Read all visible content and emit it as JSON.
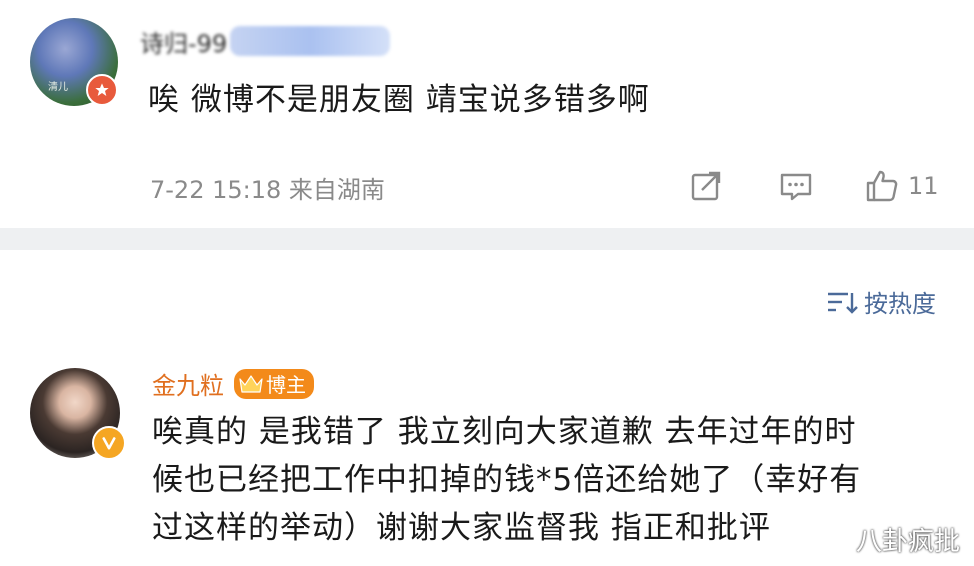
{
  "post": {
    "avatar_caption": "清儿",
    "username_partial": "诗归-99",
    "text": "唉 微博不是朋友圈 靖宝说多错多啊",
    "meta": "7-22 15:18 来自湖南",
    "like_count": "11"
  },
  "comments": {
    "sort_label": "按热度",
    "items": [
      {
        "name": "金九粒",
        "badge": "博主",
        "lines": [
          "唉真的 是我错了 我立刻向大家道歉 去年过年的时",
          "候也已经把工作中扣掉的钱*5倍还给她了（幸好有",
          "过这样的举动）谢谢大家监督我 指正和批评"
        ]
      }
    ]
  },
  "watermark": "八卦疯批",
  "colors": {
    "accent_blue": "#4b6a99",
    "name_orange": "#e06f1f",
    "badge_orange": "#f38a1a",
    "meta_gray": "#8a8a8a",
    "divider_gray": "#eef0f2"
  }
}
